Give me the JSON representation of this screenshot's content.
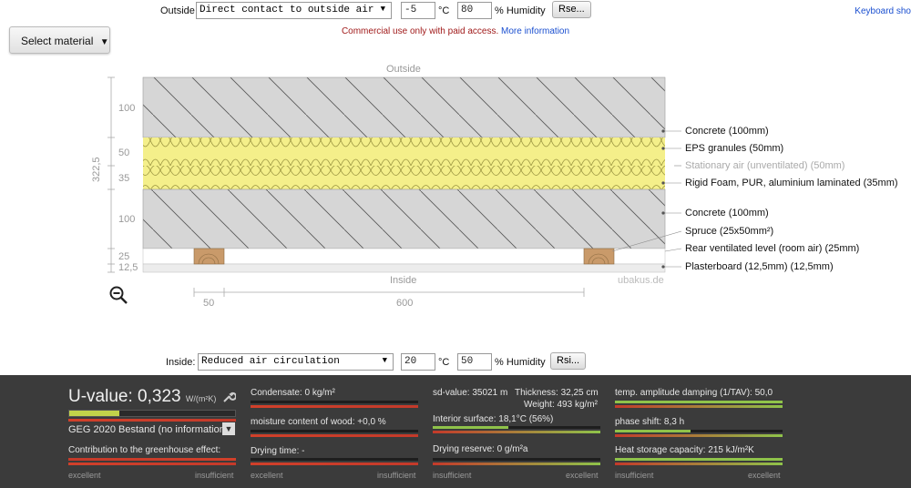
{
  "top": {
    "outside_label": "Outside",
    "outside_select": "Direct contact to outside air",
    "temp": "-5",
    "temp_unit": "°C",
    "humidity": "80",
    "humidity_label": "% Humidity",
    "rse_button": "Rse...",
    "keyboard_link": "Keyboard sho",
    "select_material": "Select material",
    "notice_red": "Commercial use only with paid access.",
    "notice_link": "More information"
  },
  "diagram": {
    "outside_label": "Outside",
    "inside_label": "Inside",
    "watermark": "ubakus.de",
    "total_thickness": "322,5",
    "thicknesses": [
      "100",
      "50",
      "35",
      "100",
      "25",
      "12,5"
    ],
    "bottom_dims": [
      "50",
      "600"
    ],
    "legend": [
      {
        "text": "Concrete (100mm)",
        "muted": false
      },
      {
        "text": "EPS granules (50mm)",
        "muted": false
      },
      {
        "text": "Stationary air (unventilated) (50mm)",
        "muted": true
      },
      {
        "text": "Rigid Foam, PUR, aluminium laminated (35mm)",
        "muted": false
      },
      {
        "text": "Concrete (100mm)",
        "muted": false
      },
      {
        "text": "Spruce (25x50mm²)",
        "muted": false
      },
      {
        "text": "Rear ventilated level (room air) (25mm)",
        "muted": false
      },
      {
        "text": "Plasterboard (12,5mm) (12,5mm)",
        "muted": false
      }
    ],
    "colors": {
      "concrete": "#d6d6d6",
      "insulation": "#f4ef8a",
      "wood": "#c99a6a",
      "plaster": "#ececec"
    }
  },
  "inside": {
    "label": "Inside:",
    "select": "Reduced air circulation",
    "temp": "20",
    "temp_unit": "°C",
    "humidity": "50",
    "humidity_label": "% Humidity",
    "rsi_button": "Rsi..."
  },
  "panel": {
    "uvalue_label": "U-value:",
    "uvalue": "0,323",
    "uvalue_unit": "W/(m²K)",
    "uvalue_fill": 0.3,
    "standard": "GEG 2020 Bestand (no information)",
    "greenhouse": "Contribution to the greenhouse effect:",
    "condensate": "Condensate: 0 kg/m²",
    "moisture": "moisture content of wood: +0,0 %",
    "drying_time": "Drying time: -",
    "sd_value": "sd-value: 35021 m",
    "thickness": "Thickness: 32,25 cm",
    "weight": "Weight: 493 kg/m²",
    "interior_surface": "Interior surface: 18,1°C (56%)",
    "interior_fill": 0.45,
    "drying_reserve": "Drying reserve: 0 g/m²a",
    "temp_amp": "temp. amplitude damping (1/TAV): 50,0",
    "phase_shift": "phase shift: 8,3 h",
    "phase_fill": 0.45,
    "heat_storage": "Heat storage capacity: 215 kJ/m²K",
    "scale_excellent": "excellent",
    "scale_insufficient": "insufficient"
  }
}
